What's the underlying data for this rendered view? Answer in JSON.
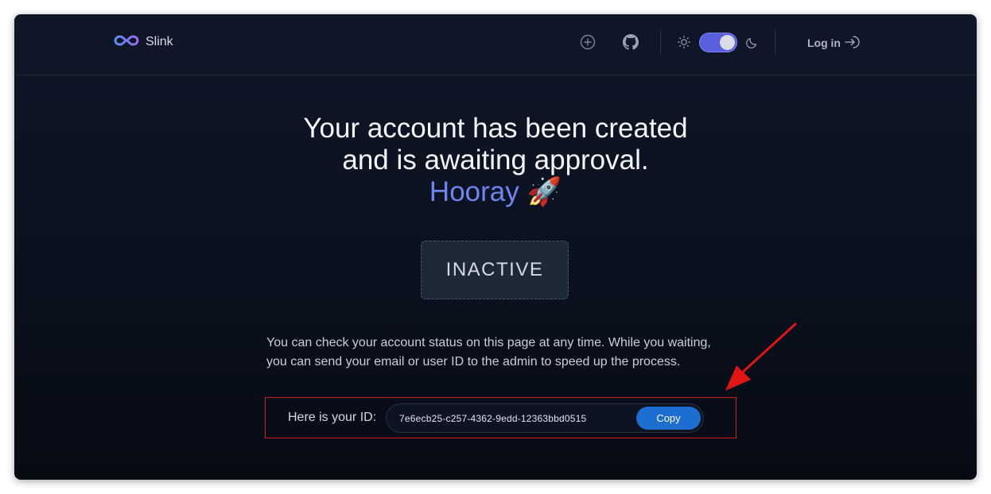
{
  "navbar": {
    "brand": "Slink",
    "icons": [
      "add-circle-icon",
      "github-icon",
      "sun-icon",
      "moon-icon",
      "log-in-icon"
    ],
    "theme_toggle_on": true,
    "login_label": "Log in"
  },
  "main": {
    "headline_line1": "Your account has been created",
    "headline_line2": "and is awaiting approval.",
    "headline_hooray": "Hooray 🚀",
    "status": "INACTIVE",
    "info_text": "You can check your account status on this page at any time. While you waiting, you can send your email or user ID to the admin to speed up the process.",
    "id_label": "Here is your ID:",
    "id_value": "7e6ecb25-c257-4362-9edd-12363bbd0515",
    "copy_label": "Copy"
  },
  "colors": {
    "accent": "#5a5fe0",
    "hooray": "#6f86f0",
    "copy_button": "#1c6fd0",
    "highlight_border": "#d11a1a",
    "annotation_arrow": "#e01616"
  }
}
